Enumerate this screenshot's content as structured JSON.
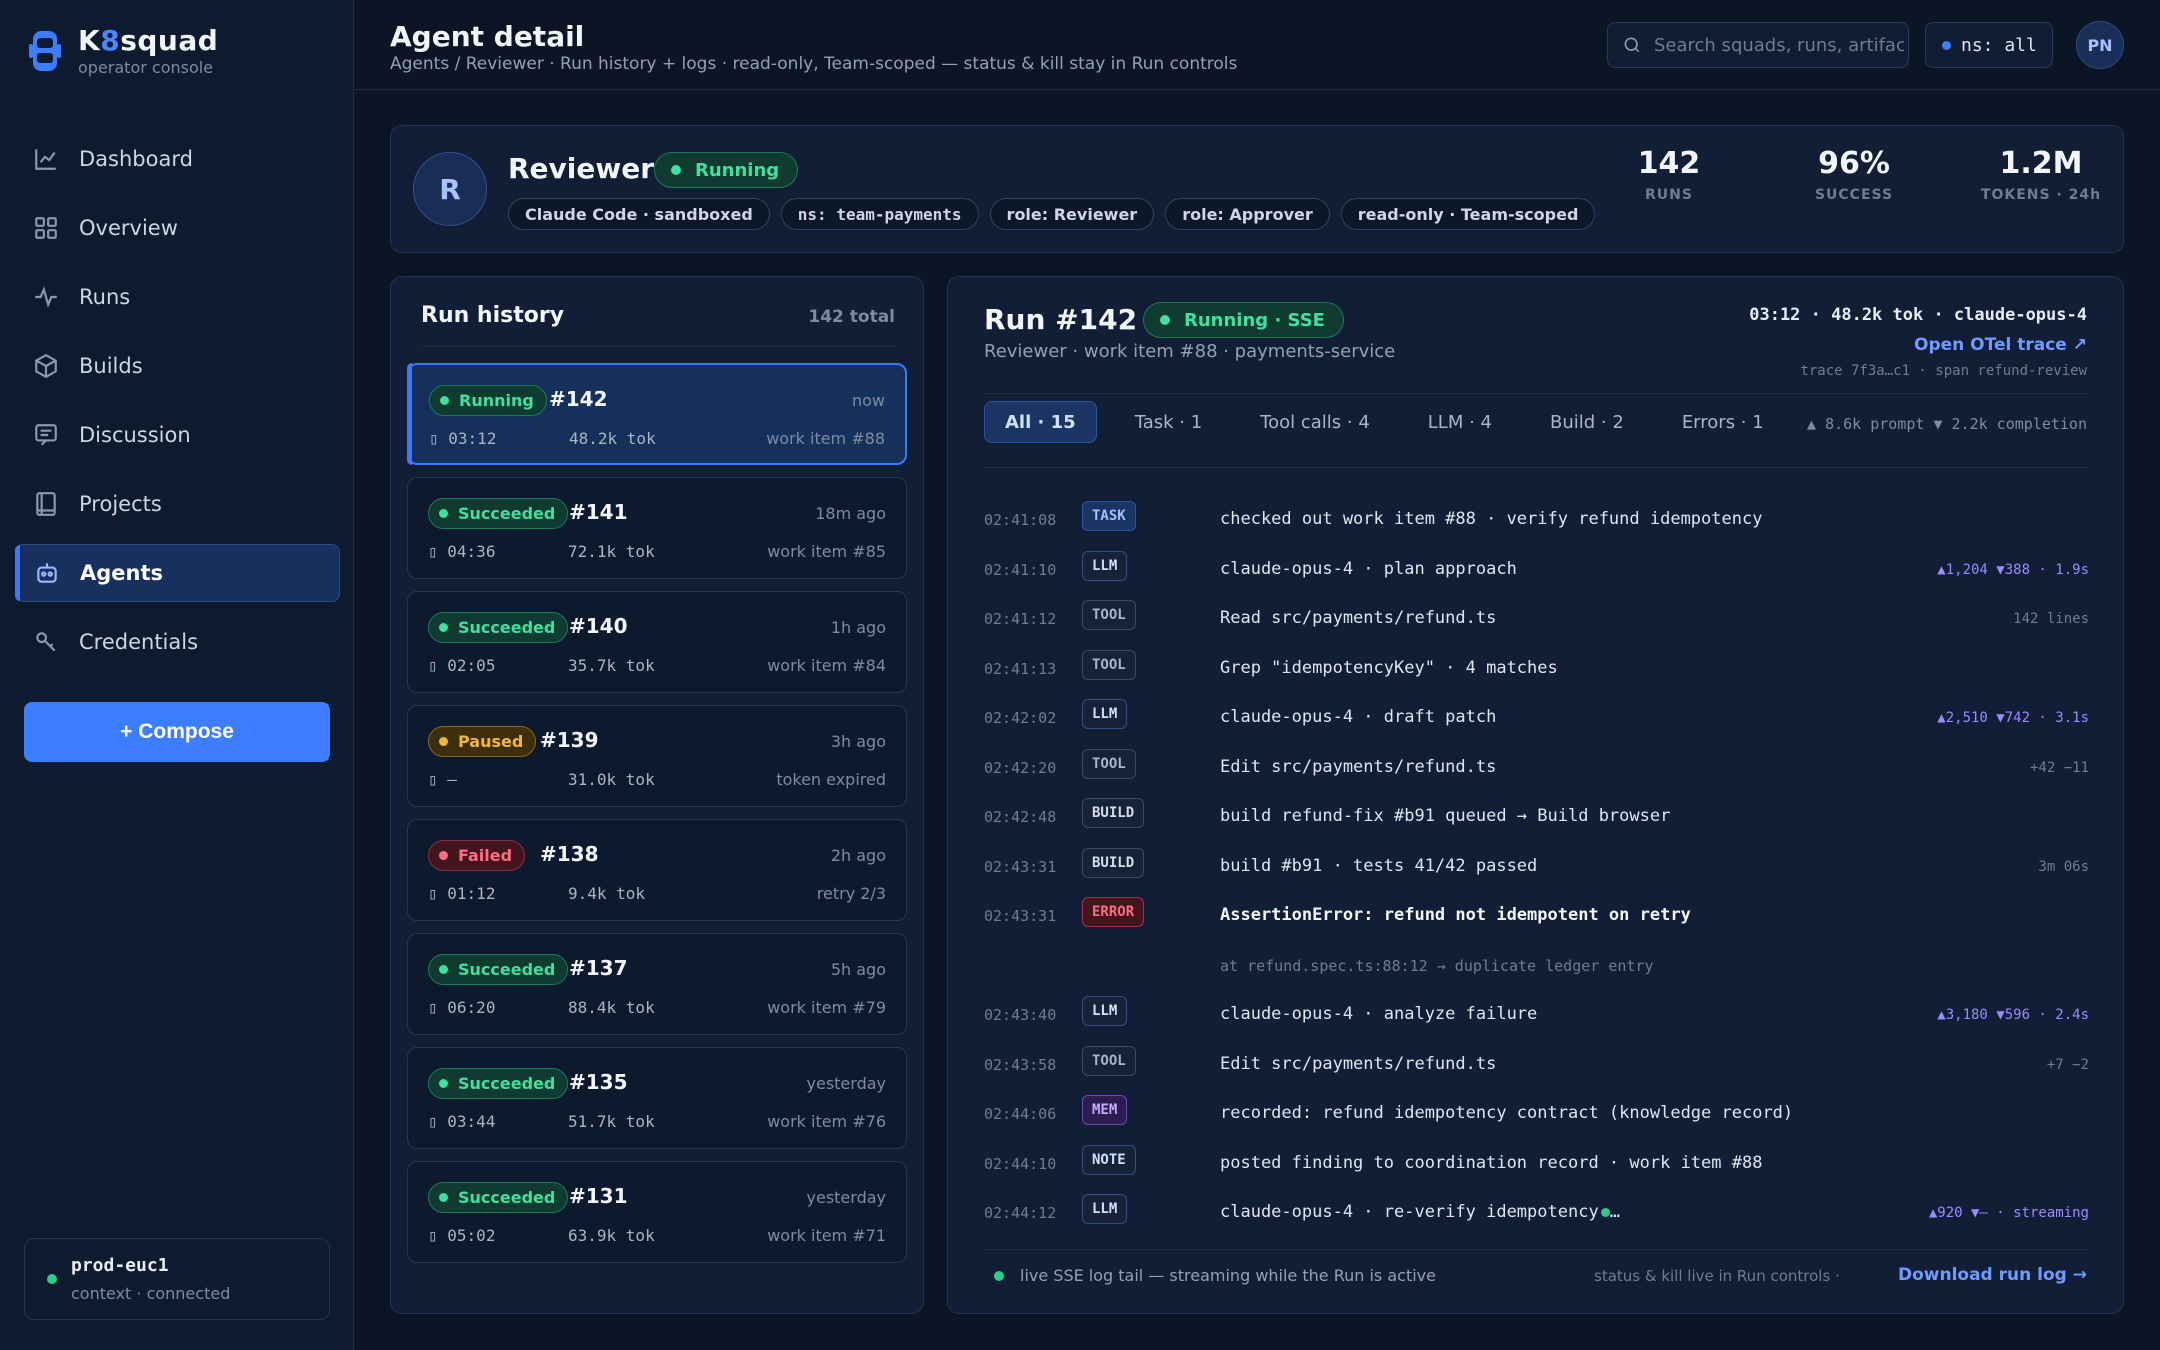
{
  "brand": {
    "name_a": "K",
    "name_b": "8",
    "name_c": "squad",
    "subtitle": "operator console"
  },
  "nav": [
    {
      "label": "Dashboard",
      "icon": "chart-line-icon"
    },
    {
      "label": "Overview",
      "icon": "grid-icon"
    },
    {
      "label": "Runs",
      "icon": "activity-icon"
    },
    {
      "label": "Builds",
      "icon": "package-icon"
    },
    {
      "label": "Discussion",
      "icon": "message-icon"
    },
    {
      "label": "Projects",
      "icon": "book-icon"
    },
    {
      "label": "Agents",
      "icon": "robot-icon",
      "active": true
    },
    {
      "label": "Credentials",
      "icon": "key-icon"
    }
  ],
  "compose_label": "+ Compose",
  "context": {
    "name": "prod-euc1",
    "status": "context · connected"
  },
  "header": {
    "title": "Agent detail",
    "subtitle": "Agents / Reviewer · Run history + logs · read-only, Team-scoped — status & kill stay in Run controls",
    "search_placeholder": "Search squads, runs, artifacts…",
    "namespace": "ns: all",
    "user_initials": "PN"
  },
  "agent": {
    "initial": "R",
    "name": "Reviewer",
    "status": "Running",
    "tags": [
      "Claude Code · sandboxed",
      "ns: team-payments",
      "role: Reviewer",
      "role: Approver",
      "read-only · Team-scoped"
    ],
    "stats": [
      {
        "value": "142",
        "label": "RUNS"
      },
      {
        "value": "96%",
        "label": "SUCCESS"
      },
      {
        "value": "1.2M",
        "label": "TOKENS · 24h"
      }
    ]
  },
  "history": {
    "title": "Run history",
    "total": "142 total",
    "runs": [
      {
        "status": "Running",
        "kind": "running",
        "id": "#142",
        "when": "now",
        "duration": "03:12",
        "tokens": "48.2k tok",
        "ref": "work item #88",
        "active": true
      },
      {
        "status": "Succeeded",
        "kind": "succeeded",
        "id": "#141",
        "when": "18m ago",
        "duration": "04:36",
        "tokens": "72.1k tok",
        "ref": "work item #85"
      },
      {
        "status": "Succeeded",
        "kind": "succeeded",
        "id": "#140",
        "when": "1h ago",
        "duration": "02:05",
        "tokens": "35.7k tok",
        "ref": "work item #84"
      },
      {
        "status": "Paused",
        "kind": "paused",
        "id": "#139",
        "when": "3h ago",
        "duration": "—",
        "tokens": "31.0k tok",
        "ref": "token expired"
      },
      {
        "status": "Failed",
        "kind": "failed",
        "id": "#138",
        "when": "2h ago",
        "duration": "01:12",
        "tokens": "9.4k tok",
        "ref": "retry 2/3"
      },
      {
        "status": "Succeeded",
        "kind": "succeeded",
        "id": "#137",
        "when": "5h ago",
        "duration": "06:20",
        "tokens": "88.4k tok",
        "ref": "work item #79"
      },
      {
        "status": "Succeeded",
        "kind": "succeeded",
        "id": "#135",
        "when": "yesterday",
        "duration": "03:44",
        "tokens": "51.7k tok",
        "ref": "work item #76"
      },
      {
        "status": "Succeeded",
        "kind": "succeeded",
        "id": "#131",
        "when": "yesterday",
        "duration": "05:02",
        "tokens": "63.9k tok",
        "ref": "work item #71"
      }
    ]
  },
  "run": {
    "title": "Run #142",
    "status": "Running · SSE",
    "subtitle": "Reviewer · work item #88 · payments-service",
    "meta": "03:12 · 48.2k tok · claude-opus-4",
    "otel_link": "Open OTel trace ↗",
    "trace": "trace 7f3a…c1 · span refund-review",
    "filters": [
      {
        "label": "All · 15",
        "active": true
      },
      {
        "label": "Task · 1"
      },
      {
        "label": "Tool calls · 4"
      },
      {
        "label": "LLM · 4"
      },
      {
        "label": "Build · 2"
      },
      {
        "label": "Errors · 1"
      }
    ],
    "token_info": "▲ 8.6k prompt ▼ 2.2k completion",
    "log": [
      {
        "ts": "02:41:08",
        "kind": "TASK",
        "cls": "task",
        "msg": "checked out work item #88 · verify refund idempotency",
        "info": ""
      },
      {
        "ts": "02:41:10",
        "kind": "LLM",
        "cls": "llm",
        "msg": "claude-opus-4 · plan approach",
        "info": "▲1,204 ▼388 · 1.9s"
      },
      {
        "ts": "02:41:12",
        "kind": "TOOL",
        "cls": "tool",
        "msg": "Read src/payments/refund.ts",
        "info": "142 lines"
      },
      {
        "ts": "02:41:13",
        "kind": "TOOL",
        "cls": "tool",
        "msg": "Grep \"idempotencyKey\" · 4 matches",
        "info": ""
      },
      {
        "ts": "02:42:02",
        "kind": "LLM",
        "cls": "llm",
        "msg": "claude-opus-4 · draft patch",
        "info": "▲2,510 ▼742 · 3.1s"
      },
      {
        "ts": "02:42:20",
        "kind": "TOOL",
        "cls": "tool",
        "msg": "Edit src/payments/refund.ts",
        "info": "+42 −11"
      },
      {
        "ts": "02:42:48",
        "kind": "BUILD",
        "cls": "build",
        "msg": "build refund-fix #b91 queued → Build browser",
        "info": ""
      },
      {
        "ts": "02:43:31",
        "kind": "BUILD",
        "cls": "build",
        "msg": "build #b91 · tests 41/42 passed",
        "info": "3m 06s"
      },
      {
        "ts": "02:43:31",
        "kind": "ERROR",
        "cls": "error",
        "msg": "AssertionError: refund not idempotent on retry",
        "info": ""
      },
      {
        "ts": "",
        "kind": "",
        "cls": "",
        "msg": "at refund.spec.ts:88:12 → duplicate ledger entry",
        "info": ""
      },
      {
        "ts": "02:43:40",
        "kind": "LLM",
        "cls": "llm",
        "msg": "claude-opus-4 · analyze failure",
        "info": "▲3,180 ▼596 · 2.4s"
      },
      {
        "ts": "02:43:58",
        "kind": "TOOL",
        "cls": "tool",
        "msg": "Edit src/payments/refund.ts",
        "info": "+7 −2"
      },
      {
        "ts": "02:44:06",
        "kind": "MEM",
        "cls": "mem",
        "msg": "recorded: refund idempotency contract (knowledge record)",
        "info": ""
      },
      {
        "ts": "02:44:10",
        "kind": "NOTE",
        "cls": "note",
        "msg": "posted finding to coordination record · work item #88",
        "info": ""
      },
      {
        "ts": "02:44:12",
        "kind": "LLM",
        "cls": "llm",
        "msg": "claude-opus-4 · re-verify idempotency",
        "info": "▲920 ▼— · streaming",
        "streaming": true,
        "tail": "…"
      }
    ],
    "footer": {
      "live": "live SSE log tail — streaming while the Run is active",
      "note": "status & kill live in Run controls ·",
      "download": "Download run log →"
    }
  },
  "colors": {
    "accent": "#3d7dff",
    "success": "#3fe0a0",
    "warning": "#f2b63a",
    "danger": "#ff6b82",
    "background": "#0b1526"
  }
}
